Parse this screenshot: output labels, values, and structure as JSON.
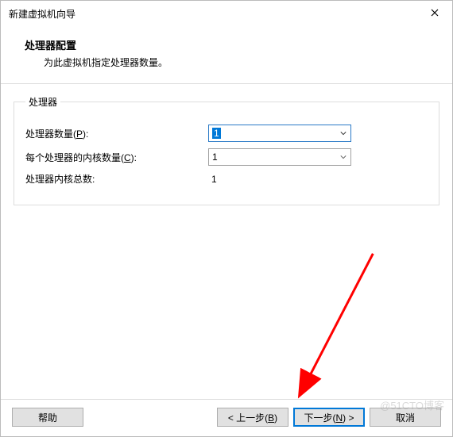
{
  "window": {
    "title": "新建虚拟机向导"
  },
  "header": {
    "title": "处理器配置",
    "subtitle": "为此虚拟机指定处理器数量。"
  },
  "group": {
    "legend": "处理器",
    "rows": {
      "processors": {
        "label_pre": "处理器数量(",
        "hotkey": "P",
        "label_post": "):",
        "value": "1"
      },
      "cores": {
        "label_pre": "每个处理器的内核数量(",
        "hotkey": "C",
        "label_post": "):",
        "value": "1"
      },
      "total": {
        "label": "处理器内核总数:",
        "value": "1"
      }
    }
  },
  "footer": {
    "help": "帮助",
    "back_pre": "< 上一步(",
    "back_hotkey": "B",
    "back_post": ")",
    "next_pre": "下一步(",
    "next_hotkey": "N",
    "next_post": ") >",
    "cancel": "取消"
  },
  "watermark": "@51CTO博客"
}
